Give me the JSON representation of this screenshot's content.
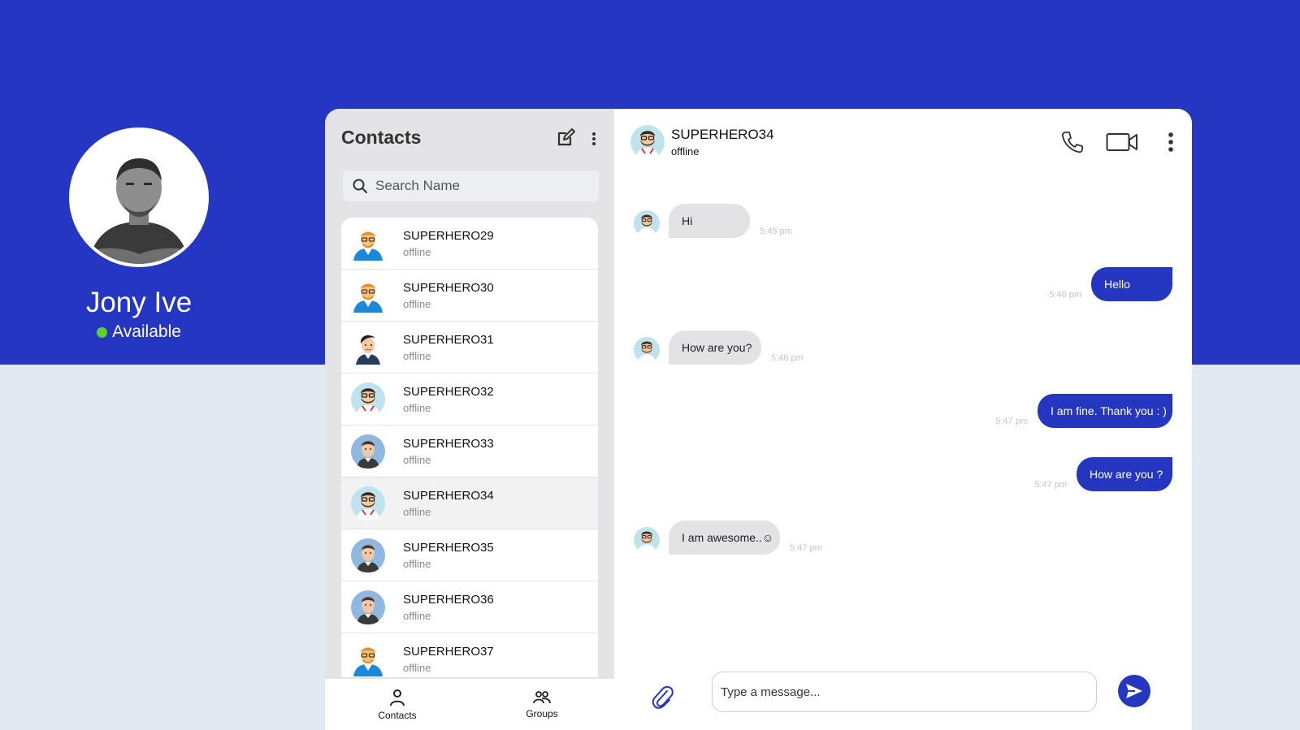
{
  "profile": {
    "name": "Jony Ive",
    "status": "Available",
    "status_color": "#5fcf2e"
  },
  "colors": {
    "brand_blue": "#2537c2",
    "page_bg": "#e3e9f2",
    "sidebar_bg": "#e4e4e6",
    "incoming_bubble": "#e3e3e5",
    "outgoing_bubble": "#2536c1"
  },
  "sidebar": {
    "title": "Contacts",
    "compose_icon": "edit-icon",
    "menu_icon": "more-vertical-icon",
    "search": {
      "placeholder": "Search Name",
      "value": ""
    },
    "contacts": [
      {
        "name": "SUPERHERO29",
        "status": "offline",
        "avatar": "orange-hair-glasses"
      },
      {
        "name": "SUPERHERO30",
        "status": "offline",
        "avatar": "orange-hair-glasses"
      },
      {
        "name": "SUPERHERO31",
        "status": "offline",
        "avatar": "dark-hair"
      },
      {
        "name": "SUPERHERO32",
        "status": "offline",
        "avatar": "bearded-glasses"
      },
      {
        "name": "SUPERHERO33",
        "status": "offline",
        "avatar": "blue-circle-man"
      },
      {
        "name": "SUPERHERO34",
        "status": "offline",
        "avatar": "bearded-glasses",
        "active": true
      },
      {
        "name": "SUPERHERO35",
        "status": "offline",
        "avatar": "blue-circle-man"
      },
      {
        "name": "SUPERHERO36",
        "status": "offline",
        "avatar": "blue-circle-man"
      },
      {
        "name": "SUPERHERO37",
        "status": "offline",
        "avatar": "orange-hair-glasses"
      }
    ],
    "nav": [
      {
        "label": "Contacts",
        "icon": "user-icon"
      },
      {
        "label": "Groups",
        "icon": "users-icon"
      }
    ]
  },
  "chat": {
    "contact_name": "SUPERHERO34",
    "contact_status": "offline",
    "call_icon": "phone-icon",
    "video_icon": "video-icon",
    "menu_icon": "more-vertical-icon",
    "messages": [
      {
        "direction": "in",
        "text": "Hi",
        "time": "5:45 pm"
      },
      {
        "direction": "out",
        "text": "Hello",
        "time": "5:46 pm"
      },
      {
        "direction": "in",
        "text": "How are you?",
        "time": "5:46 pm"
      },
      {
        "direction": "out",
        "text": "I am fine. Thank you : )",
        "time": "5:47 pm"
      },
      {
        "direction": "out",
        "text": "How are you ?",
        "time": "5:47 pm"
      },
      {
        "direction": "in",
        "text": "I am awesome..☺",
        "time": "5:47 pm"
      }
    ],
    "composer": {
      "placeholder": "Type a message...",
      "value": "",
      "attach_icon": "paperclip-icon",
      "send_icon": "send-icon"
    }
  }
}
